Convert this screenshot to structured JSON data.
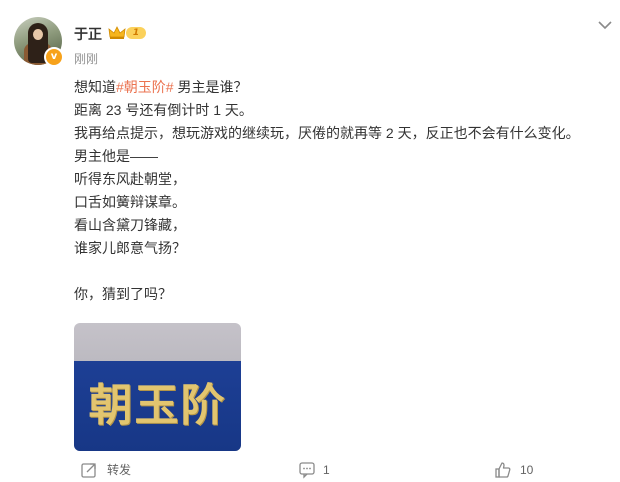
{
  "post": {
    "author": "于正",
    "level_badge": "1",
    "time": "刚刚",
    "lines": {
      "l1_pre": "想知道",
      "l1_tag": "#朝玉阶#",
      "l1_post": " 男主是谁？",
      "l2": "距离 23 号还有倒计时 1 天。",
      "l3": "我再给点提示，想玩游戏的继续玩，厌倦的就再等 2 天，反正也不会有什么变化。",
      "l4": "男主他是——",
      "l5": "听得东风赴朝堂，",
      "l6": "口舌如簧辩谋章。",
      "l7": "看山含黛刀锋藏，",
      "l8": "谁家儿郎意气扬？",
      "l9": "你，猜到了吗？"
    },
    "image_text": "朝玉阶",
    "colors": {
      "hashtag": "#eb7350",
      "text": "#333333",
      "meta": "#939393",
      "badge": "#f7a21b"
    }
  },
  "actions": {
    "repost_label": "转发",
    "comment_count": "1",
    "like_count": "10"
  },
  "icons": {
    "verified": "verified-v-icon",
    "crown": "crown-icon",
    "menu": "chevron-down-icon",
    "repost": "share-icon",
    "comment": "comment-icon",
    "like": "thumbs-up-icon"
  }
}
